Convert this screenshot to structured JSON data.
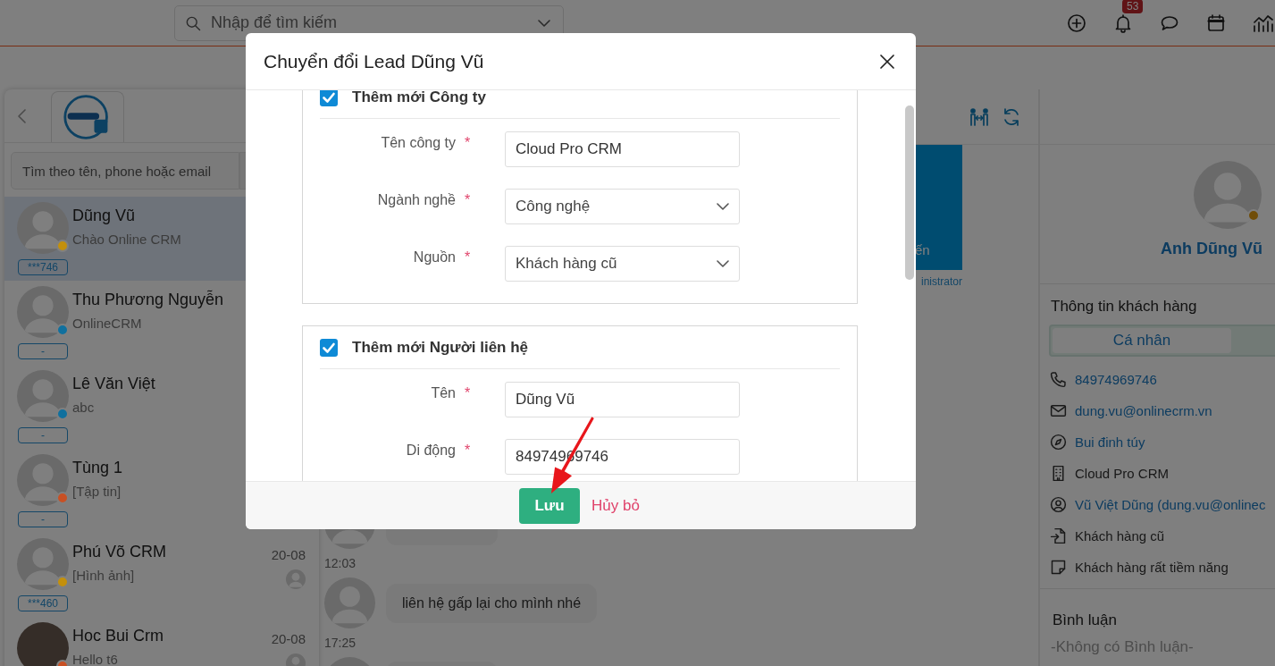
{
  "top_bar": {
    "search": {
      "placeholder": "Nhập để tìm kiếm"
    },
    "notifications_badge": "53"
  },
  "contacts_panel": {
    "search": {
      "placeholder": "Tìm theo tên, phone hoặc email"
    },
    "contacts": [
      {
        "name": "Dũng Vũ",
        "message": "Chào Online CRM",
        "tag": "***746",
        "color": "#c4900c",
        "selected": true,
        "kind": "placeholder"
      },
      {
        "name": "Thu Phương Nguyễn",
        "message": "OnlineCRM",
        "tag": "-",
        "color": "#10709e",
        "selected": false,
        "kind": "placeholder"
      },
      {
        "name": "Lê Văn Việt",
        "message": "abc",
        "tag": "-",
        "color": "#10709e",
        "selected": false,
        "kind": "placeholder"
      },
      {
        "name": "Tùng 1",
        "message": "[Tập tin]",
        "tag": "-",
        "color": "#c85024",
        "selected": false,
        "kind": "placeholder"
      },
      {
        "name": "Phú Võ CRM",
        "message": "[Hình ảnh]",
        "tag": "***460",
        "color": "#c4900c",
        "selected": false,
        "kind": "placeholder",
        "date": "20-08",
        "assigned": true
      },
      {
        "name": "Hoc Bui Crm",
        "message": "Hello t6",
        "color": "#c85024",
        "selected": false,
        "kind": "photo",
        "date": "20-08",
        "assigned": true
      }
    ]
  },
  "chat": {
    "card_text": "ến",
    "card_caption": "inistrator",
    "items": [
      {
        "kind": "message"
      },
      {
        "kind": "time",
        "text": "12:03"
      },
      {
        "kind": "message",
        "text": "liên hệ gấp lại cho mình nhé"
      },
      {
        "kind": "time",
        "text": "17:25"
      },
      {
        "kind": "message"
      }
    ]
  },
  "customer": {
    "name": "Anh Dũng Vũ",
    "info_title": "Thông tin khách hàng",
    "segments": [
      {
        "label": "Cá nhân",
        "selected": true
      }
    ],
    "details": [
      {
        "kind": "phone",
        "text": "84974969746",
        "link": true
      },
      {
        "kind": "email",
        "text": "dung.vu@onlinecrm.vn",
        "link": true
      },
      {
        "kind": "address",
        "text": "Bui đinh túy",
        "link": true
      },
      {
        "kind": "company",
        "text": "Cloud Pro CRM",
        "link": false
      },
      {
        "kind": "owner",
        "text": "Vũ Việt Dũng (dung.vu@onlinec",
        "link": true
      },
      {
        "kind": "source",
        "text": "Khách hàng cũ",
        "link": false
      },
      {
        "kind": "rating",
        "text": "Khách hàng rất tiềm năng",
        "link": false
      }
    ],
    "comments_title": "Bình luận",
    "comments_empty": "-Không có Bình luận-"
  },
  "modal": {
    "title": "Chuyển đổi Lead Dũng Vũ",
    "sections": [
      {
        "title": "Thêm mới Công ty",
        "checked": true,
        "fields": [
          {
            "label": "Tên công ty",
            "required_mark": "*",
            "kind": "text",
            "value": "Cloud Pro CRM"
          },
          {
            "label": "Ngành nghề",
            "required_mark": "*",
            "kind": "select",
            "value": "Công nghệ"
          },
          {
            "label": "Nguồn",
            "required_mark": "*",
            "kind": "select",
            "value": "Khách hàng cũ"
          }
        ]
      },
      {
        "title": "Thêm mới Người liên hệ",
        "checked": true,
        "fields": [
          {
            "label": "Tên",
            "required_mark": "*",
            "kind": "text",
            "value": "Dũng Vũ"
          },
          {
            "label": "Di động",
            "required_mark": "*",
            "kind": "text",
            "value": "84974969746"
          }
        ]
      }
    ],
    "buttons": [
      {
        "label": "Lưu",
        "kind": "primary"
      },
      {
        "label": "Hủy bỏ",
        "kind": "link"
      }
    ]
  }
}
